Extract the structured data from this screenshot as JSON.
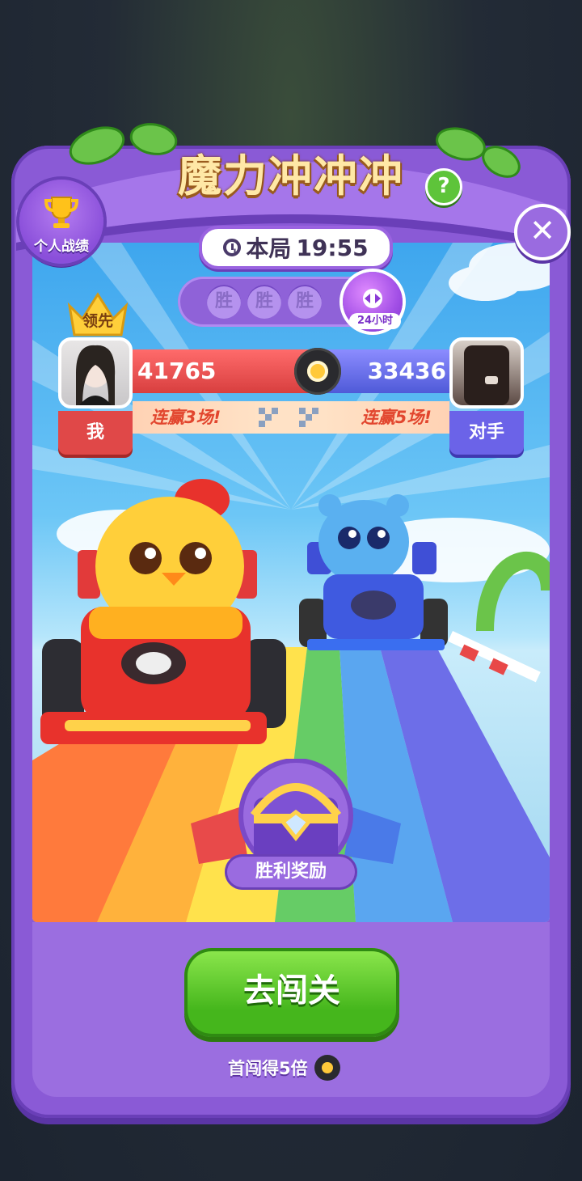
{
  "header": {
    "title": "魔力冲冲冲",
    "help_label": "?",
    "close_label": "✕",
    "trophy_label": "个人战绩"
  },
  "round": {
    "timer_prefix": "本局",
    "timer_value": "19:55"
  },
  "wins": {
    "slots": [
      "胜",
      "胜",
      "胜"
    ],
    "swap_badge": "24小时"
  },
  "players": {
    "lead_badge": "领先",
    "me": {
      "score": "41765",
      "streak": "连赢3场!",
      "tag": "我"
    },
    "opponent": {
      "score": "33436",
      "streak": "连赢5场!",
      "tag": "对手"
    }
  },
  "reward": {
    "label": "胜利奖励"
  },
  "footer": {
    "go_button": "去闯关",
    "bonus_text": "首闯得5倍"
  },
  "icons": {
    "trophy": "trophy-icon",
    "clock": "clock-icon",
    "swap": "swap-arrows-icon",
    "crown": "crown-icon",
    "wheel": "wheel-icon",
    "chest": "treasure-chest-icon"
  },
  "colors": {
    "panel_purple": "#8a5ad6",
    "me_red": "#e04848",
    "opponent_blue": "#6b63e8",
    "go_green": "#45b61c",
    "title_gold": "#ffe8a6"
  }
}
